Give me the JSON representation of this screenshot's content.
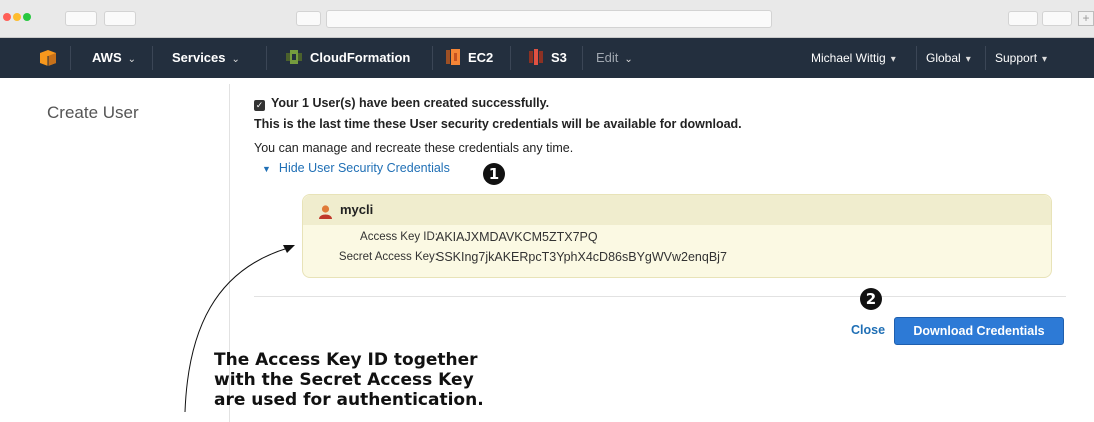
{
  "nav": {
    "aws_label": "AWS",
    "services_label": "Services",
    "cloudformation_label": "CloudFormation",
    "ec2_label": "EC2",
    "s3_label": "S3",
    "edit_label": "Edit",
    "user_label": "Michael Wittig",
    "region_label": "Global",
    "support_label": "Support",
    "caret": "⌄",
    "dropdown_caret": "▾"
  },
  "sidebar": {
    "title": "Create User"
  },
  "main": {
    "success_message": "Your 1 User(s) have been created successfully.",
    "last_time_message": "This is the last time these User security credentials will be available for download.",
    "manage_message": "You can manage and recreate these credentials any time.",
    "hide_credentials_link": "Hide User Security Credentials",
    "check_glyph": "✓",
    "toggle_glyph": "▼"
  },
  "credentials": {
    "user_name": "mycli",
    "access_key_label": "Access Key ID:",
    "access_key_value": "AKIAJXMDAVKCM5ZTX7PQ",
    "secret_key_label": "Secret Access Key:",
    "secret_key_value": "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"
  },
  "actions": {
    "close_label": "Close",
    "download_label": "Download Credentials"
  },
  "callouts": {
    "one": "1",
    "two": "2"
  },
  "annotation": {
    "line1": "The Access Key ID together",
    "line2": "with the Secret Access Key",
    "line3": "are used for authentication."
  },
  "browser": {
    "new_tab_glyph": "+"
  },
  "colors": {
    "nav_bg": "#232f3e",
    "link": "#1f6fb5",
    "primary_button": "#2d7ad6",
    "credentials_box": "#fbf9e3",
    "aws_orange": "#f7981d",
    "cloudformation_green": "#759c3e",
    "ec2_orange": "#f58536",
    "s3_red": "#e05243"
  }
}
